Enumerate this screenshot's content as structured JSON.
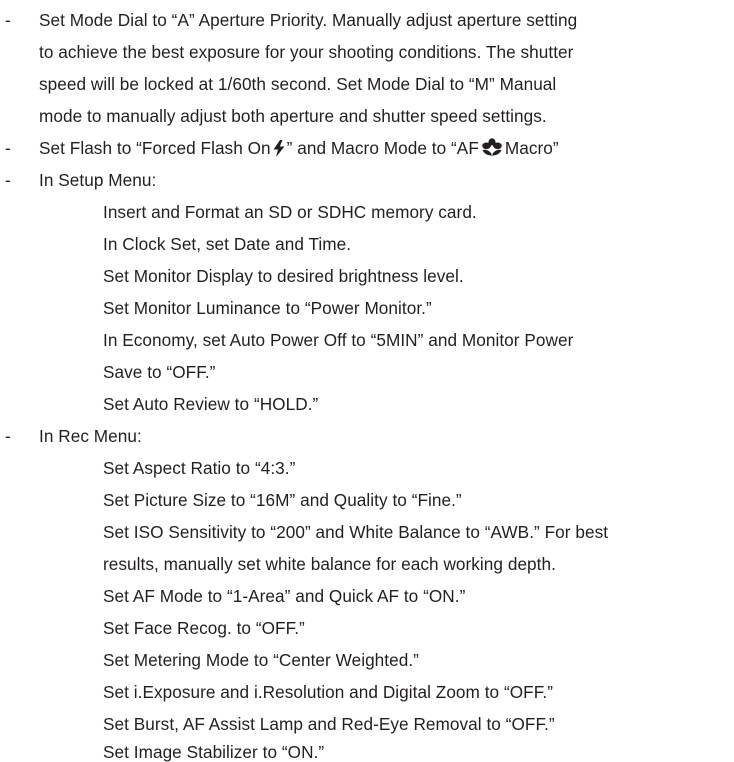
{
  "bullet": "-",
  "items": [
    {
      "lines": [
        "Set Mode Dial to “A” Aperture Priority. Manually adjust aperture setting",
        "to achieve the best exposure for your shooting conditions. The shutter",
        "speed will be locked at 1/60th second. Set Mode Dial to “M” Manual",
        "mode to manually adjust both aperture and shutter speed settings."
      ]
    },
    {
      "flash_line": {
        "part1": "Set Flash to “Forced Flash On",
        "part2": "” and Macro Mode to “AF",
        "part3": "Macro”"
      },
      "icons": [
        "flash-icon",
        "macro-flower-icon"
      ]
    },
    {
      "heading": "In Setup Menu:",
      "sub": [
        "Insert and Format an SD or SDHC memory card.",
        "In Clock Set, set Date and Time.",
        "Set Monitor Display to desired brightness level.",
        "Set Monitor Luminance to “Power Monitor.”",
        "In Economy, set Auto Power Off to “5MIN” and Monitor Power",
        "Save to “OFF.”",
        "Set Auto Review to “HOLD.”"
      ]
    },
    {
      "heading": "In Rec Menu:",
      "sub": [
        "Set Aspect Ratio to “4:3.”",
        "Set Picture Size to “16M” and Quality to “Fine.”",
        "Set ISO Sensitivity to “200” and White Balance to “AWB.” For best",
        "results, manually set white balance for each working depth.",
        "Set AF Mode to “1-Area” and Quick AF to “ON.”",
        "Set Face Recog. to “OFF.”",
        "Set Metering Mode to “Center Weighted.”",
        "Set i.Exposure and i.Resolution and Digital Zoom to “OFF.”",
        "Set Burst, AF Assist Lamp and Red-Eye Removal to “OFF.”",
        "Set Image Stabilizer to “ON.”"
      ]
    }
  ]
}
